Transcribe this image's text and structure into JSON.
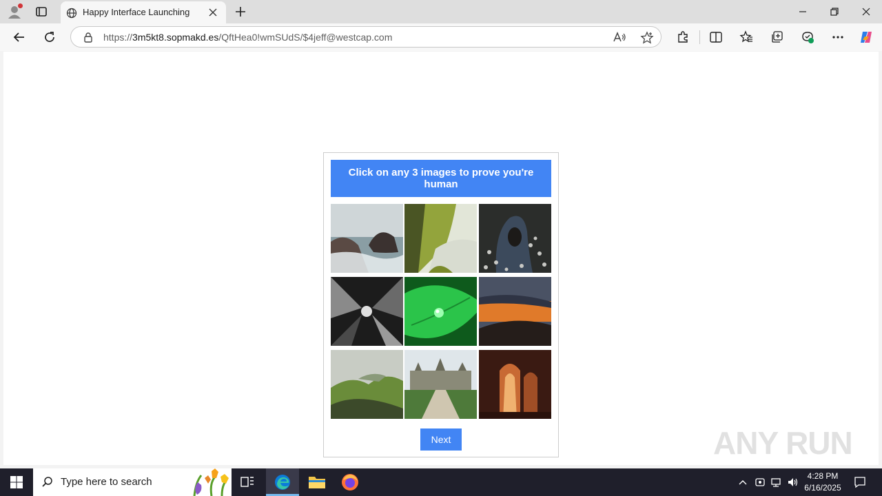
{
  "browser": {
    "tab_title": "Happy Interface Launching",
    "url_scheme": "https://",
    "url_host": "3m5kt8.sopmakd.es",
    "url_path": "/QftHea0!wmSUdS/$4jeff@westcap.com"
  },
  "captcha": {
    "heading": "Click on any 3 images to prove you're human",
    "tiles": [
      {
        "name": "sea-rocks",
        "colors": [
          "#cfd6d8",
          "#8a9ea4",
          "#3b3230"
        ]
      },
      {
        "name": "green-coast",
        "colors": [
          "#e2e6d8",
          "#93a43c",
          "#4a5524"
        ]
      },
      {
        "name": "hooded-figure",
        "colors": [
          "#2b2d2b",
          "#3c4a5c",
          "#c8c8c4"
        ]
      },
      {
        "name": "concrete-towers",
        "colors": [
          "#4a4a4a",
          "#8a8a8a",
          "#1c1c1c"
        ]
      },
      {
        "name": "green-leaf-drop",
        "colors": [
          "#0e5a1c",
          "#2bc44a",
          "#9dffb0"
        ]
      },
      {
        "name": "sunset-hills",
        "colors": [
          "#4a5264",
          "#e07a2a",
          "#251d1a"
        ]
      },
      {
        "name": "green-mountains",
        "colors": [
          "#c8ccc4",
          "#6a8c3a",
          "#3c4a2a"
        ]
      },
      {
        "name": "castle",
        "colors": [
          "#dfe6ea",
          "#8a8a78",
          "#4e7a3a"
        ]
      },
      {
        "name": "stone-arches",
        "colors": [
          "#3a1a12",
          "#c86a34",
          "#f0b270"
        ]
      }
    ],
    "next_label": "Next"
  },
  "watermark": {
    "text": "ANY RUN"
  },
  "taskbar": {
    "search_placeholder": "Type here to search",
    "time": "4:28 PM",
    "date": "6/16/2025"
  }
}
